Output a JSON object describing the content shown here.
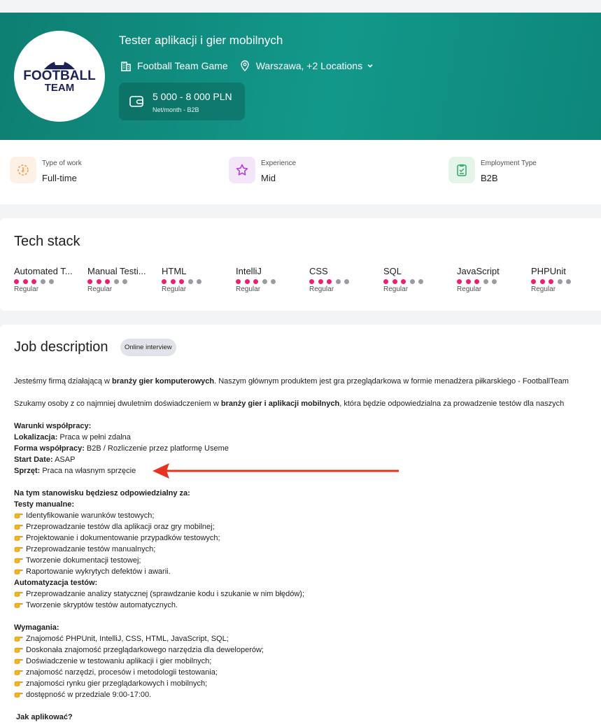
{
  "header": {
    "title": "Tester aplikacji i gier mobilnych",
    "company": "Football Team Game",
    "location": "Warszawa, +2 Locations",
    "salary": "5 000 - 8 000 PLN",
    "salary_note": "Net/month - B2B",
    "logo_line1": "FOOTBALL",
    "logo_line2": "TEAM"
  },
  "attributes": [
    {
      "label": "Type of work",
      "value": "Full-time",
      "icon": "timer-icon",
      "color": "#f5a25d"
    },
    {
      "label": "Experience",
      "value": "Mid",
      "icon": "star-icon",
      "color": "#b13ad6"
    },
    {
      "label": "Employment Type",
      "value": "B2B",
      "icon": "contract-icon",
      "color": "#2fa866"
    }
  ],
  "tech_stack": {
    "title": "Tech stack",
    "items": [
      {
        "name": "Automated T...",
        "level": "Regular",
        "dots": 3
      },
      {
        "name": "Manual Testi...",
        "level": "Regular",
        "dots": 3
      },
      {
        "name": "HTML",
        "level": "Regular",
        "dots": 3
      },
      {
        "name": "IntelliJ",
        "level": "Regular",
        "dots": 3
      },
      {
        "name": "CSS",
        "level": "Regular",
        "dots": 3
      },
      {
        "name": "SQL",
        "level": "Regular",
        "dots": 3
      },
      {
        "name": "JavaScript",
        "level": "Regular",
        "dots": 3
      },
      {
        "name": "PHPUnit",
        "level": "Regular",
        "dots": 3
      }
    ]
  },
  "description": {
    "title": "Job description",
    "badge": "Online interview",
    "intro1_a": "Jesteśmy firmą działającą w ",
    "intro1_b": "branży gier komputerowych",
    "intro1_c": ". Naszym głównym produktem jest gra przeglądarkowa w formie menadżera piłkarskiego - FootballTeam",
    "intro2_a": "Szukamy osoby z co najmniej dwuletnim doświadczeniem w ",
    "intro2_b": "branży gier i aplikacji mobilnych",
    "intro2_c": ", która będzie odpowiedzialna za prowadzenie testów dla naszych",
    "conditions_title": "Warunki współpracy:",
    "conditions": [
      {
        "key": "Lokalizacja:",
        "value": " Praca w pełni zdalna"
      },
      {
        "key": "Forma współpracy:",
        "value": " B2B / Rozliczenie przez platformę Useme"
      },
      {
        "key": "Start Date:",
        "value": " ASAP"
      },
      {
        "key": "Sprzęt:",
        "value": " Praca na własnym sprzęcie"
      }
    ],
    "resp_title": "Na tym stanowisku będziesz odpowiedzialny za:",
    "manual_title": "Testy manualne:",
    "manual": [
      "Identyfikowanie warunków testowych;",
      "Przeprowadzanie testów dla aplikacji oraz gry mobilnej;",
      "Projektowanie i dokumentowanie przypadków testowych;",
      "Przeprowadzanie testów manualnych;",
      "Tworzenie dokumentacji testowej;",
      "Raportowanie wykrytych defektów i awarii."
    ],
    "auto_title": "Automatyzacja testów:",
    "auto": [
      "Przeprowadzanie analizy statycznej (sprawdzanie kodu i szukanie w nim błędów);",
      "Tworzenie skryptów testów automatycznych."
    ],
    "req_title": "Wymagania:",
    "requirements": [
      "Znajomość PHPUnit, IntelliJ, CSS, HTML, JavaScript, SQL;",
      "Doskonała znajomość przeglądarkowego narzędzia dla deweloperów;",
      "Doświadczenie w testowaniu aplikacji i gier mobilnych;",
      "znajomość narzędzi, procesów i metodologii testowania;",
      "znajomości rynku gier przeglądarkowych i mobilnych;",
      "dostępność w przedziale 9:00-17:00."
    ],
    "apply_title": "Jak aplikować?"
  },
  "colors": {
    "accent": "#0e877b",
    "dot_on": "#ec1e72",
    "arrow": "#e8311f"
  }
}
